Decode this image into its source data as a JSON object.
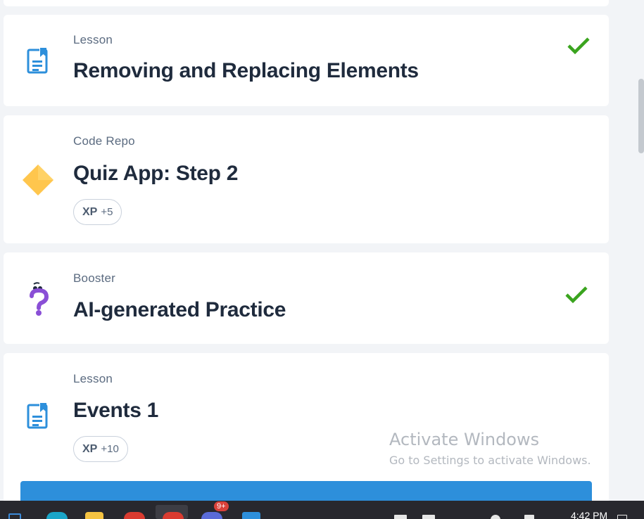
{
  "cards": [
    {
      "type": "Lesson",
      "title": "Removing and Replacing Elements",
      "icon": "lesson-document-icon",
      "completed": true
    },
    {
      "type": "Code Repo",
      "title": "Quiz App: Step 2",
      "icon": "code-repo-diamond-icon",
      "xp_label": "XP",
      "xp_value": "+5",
      "completed": false
    },
    {
      "type": "Booster",
      "title": "AI-generated Practice",
      "icon": "booster-question-icon",
      "completed": true
    },
    {
      "type": "Lesson",
      "title": "Events 1",
      "icon": "lesson-document-icon",
      "xp_label": "XP",
      "xp_value": "+10",
      "completed": false
    }
  ],
  "watermark": {
    "title": "Activate Windows",
    "subtitle": "Go to Settings to activate Windows."
  },
  "taskbar": {
    "time": "4:42 PM",
    "notification_badge": "9+"
  },
  "colors": {
    "accent_blue": "#2d8fdb",
    "check_green": "#3aa41e",
    "diamond_yellow": "#ffc64d",
    "booster_purple": "#8a4fd6"
  }
}
